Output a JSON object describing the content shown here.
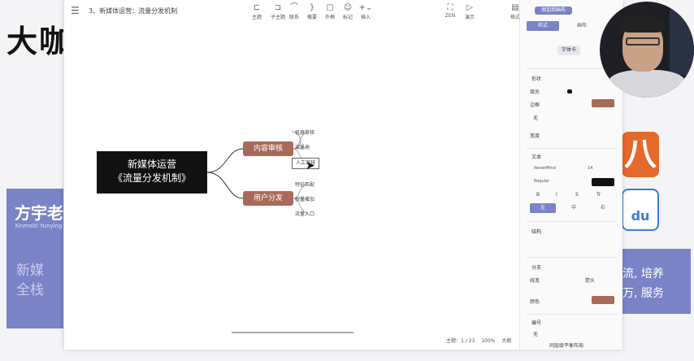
{
  "background": {
    "title": "大咖",
    "left_name": "方宇老",
    "left_subtitle": "Xinmeiti Yunying",
    "left_tags": [
      "新媒",
      "全栈"
    ],
    "right_lines": [
      "流, 培养",
      "万, 服务"
    ],
    "app_icons": [
      "八",
      "du"
    ]
  },
  "window": {
    "doc_title": "3、新媒体运营：流量分发机制",
    "toolbar": [
      {
        "label": "主题",
        "icon": "theme-icon"
      },
      {
        "label": "子主题",
        "icon": "subtopic-icon"
      },
      {
        "label": "联系",
        "icon": "relation-icon"
      },
      {
        "label": "概要",
        "icon": "summary-icon"
      },
      {
        "label": "外框",
        "icon": "boundary-icon"
      },
      {
        "label": "标记",
        "icon": "marker-icon"
      },
      {
        "label": "插入",
        "icon": "insert-icon"
      },
      {
        "label": "ZEN",
        "icon": "zen-icon"
      },
      {
        "label": "演示",
        "icon": "present-icon"
      },
      {
        "label": "格式",
        "icon": "format-icon"
      }
    ],
    "mindmap": {
      "root": [
        "新媒体运营",
        "《流量分发机制》"
      ],
      "branches": [
        {
          "label": "内容审核",
          "children": [
            "机器审核",
            "流量池",
            "人工审核"
          ]
        },
        {
          "label": "用户分发",
          "children": [
            "特征匹配",
            "权重增加",
            "流量入口"
          ]
        }
      ]
    },
    "status": {
      "topics": "主题：1 / 23",
      "zoom": "100%",
      "size": "大纲"
    }
  },
  "panel": {
    "top_button": "添加到画布",
    "tabs": [
      "样式",
      "画布"
    ],
    "style_tab": "字体卡",
    "sections": {
      "shape": "形状",
      "fill": "填充",
      "border": "边框",
      "none": "无",
      "width": "宽度",
      "text": "文本",
      "font": "NeverMind",
      "font_size": "14",
      "font_weight": "Regular",
      "style_buttons": [
        "B",
        "I",
        "S",
        "Tr"
      ],
      "align_buttons": [
        "左",
        "中",
        "右"
      ],
      "structure": "结构",
      "branch": "分支",
      "line_width": "线宽",
      "line_end": "箭头",
      "color": "颜色",
      "numbering": "编号",
      "numbering_value": "无",
      "auto_balance": "同层级平衡布局"
    },
    "colors": {
      "accent": "#7b83c7",
      "node": "#a86a5a",
      "text_color": "#111111"
    }
  }
}
